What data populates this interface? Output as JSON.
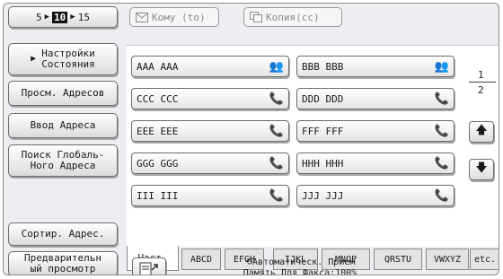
{
  "pager": {
    "prev_page": "5",
    "current_page": "10",
    "next_page": "15"
  },
  "top_fields": {
    "to_label": "Кому (to)",
    "cc_label": "Копия(cc)"
  },
  "sidebar": {
    "settings_line1": "Настройки",
    "settings_line2": "Состояния",
    "view_address": "Просм. Адресов",
    "enter_address": "Ввод Адреса",
    "global_search_line1": "Поиск Глобаль-",
    "global_search_line2": "Ного Адреса",
    "sort_address": "Сортир. Адрес.",
    "preview_line1": "Предварительн",
    "preview_line2": "ый просмотр"
  },
  "entries": [
    {
      "name": "AAA AAA",
      "icon": "group-icon"
    },
    {
      "name": "BBB BBB",
      "icon": "group-icon"
    },
    {
      "name": "CCC CCC",
      "icon": "phone-icon"
    },
    {
      "name": "DDD DDD",
      "icon": "phone-icon"
    },
    {
      "name": "EEE EEE",
      "icon": "phone-icon"
    },
    {
      "name": "FFF FFF",
      "icon": "phone-icon"
    },
    {
      "name": "GGG GGG",
      "icon": "phone-icon"
    },
    {
      "name": "HHH HHH",
      "icon": "phone-icon"
    },
    {
      "name": "III III",
      "icon": "phone-icon"
    },
    {
      "name": "JJJ JJJ",
      "icon": "phone-icon"
    }
  ],
  "page_indicator": {
    "current": "1",
    "total": "2"
  },
  "tabs": [
    {
      "label": "Част.",
      "active": true
    },
    {
      "label": "ABCD"
    },
    {
      "label": "EFGH"
    },
    {
      "label": "IJKL"
    },
    {
      "label": "MNOP"
    },
    {
      "label": "QRSTU"
    },
    {
      "label": "VWXYZ"
    },
    {
      "label": "etc."
    }
  ],
  "status": {
    "line1": "Автоматическ. Прием",
    "line2": "Память Для Факса:100%"
  },
  "colors": {
    "panel_bg": "#eceef2",
    "button_border": "#6c6c6c",
    "text": "#1a1a1a"
  }
}
